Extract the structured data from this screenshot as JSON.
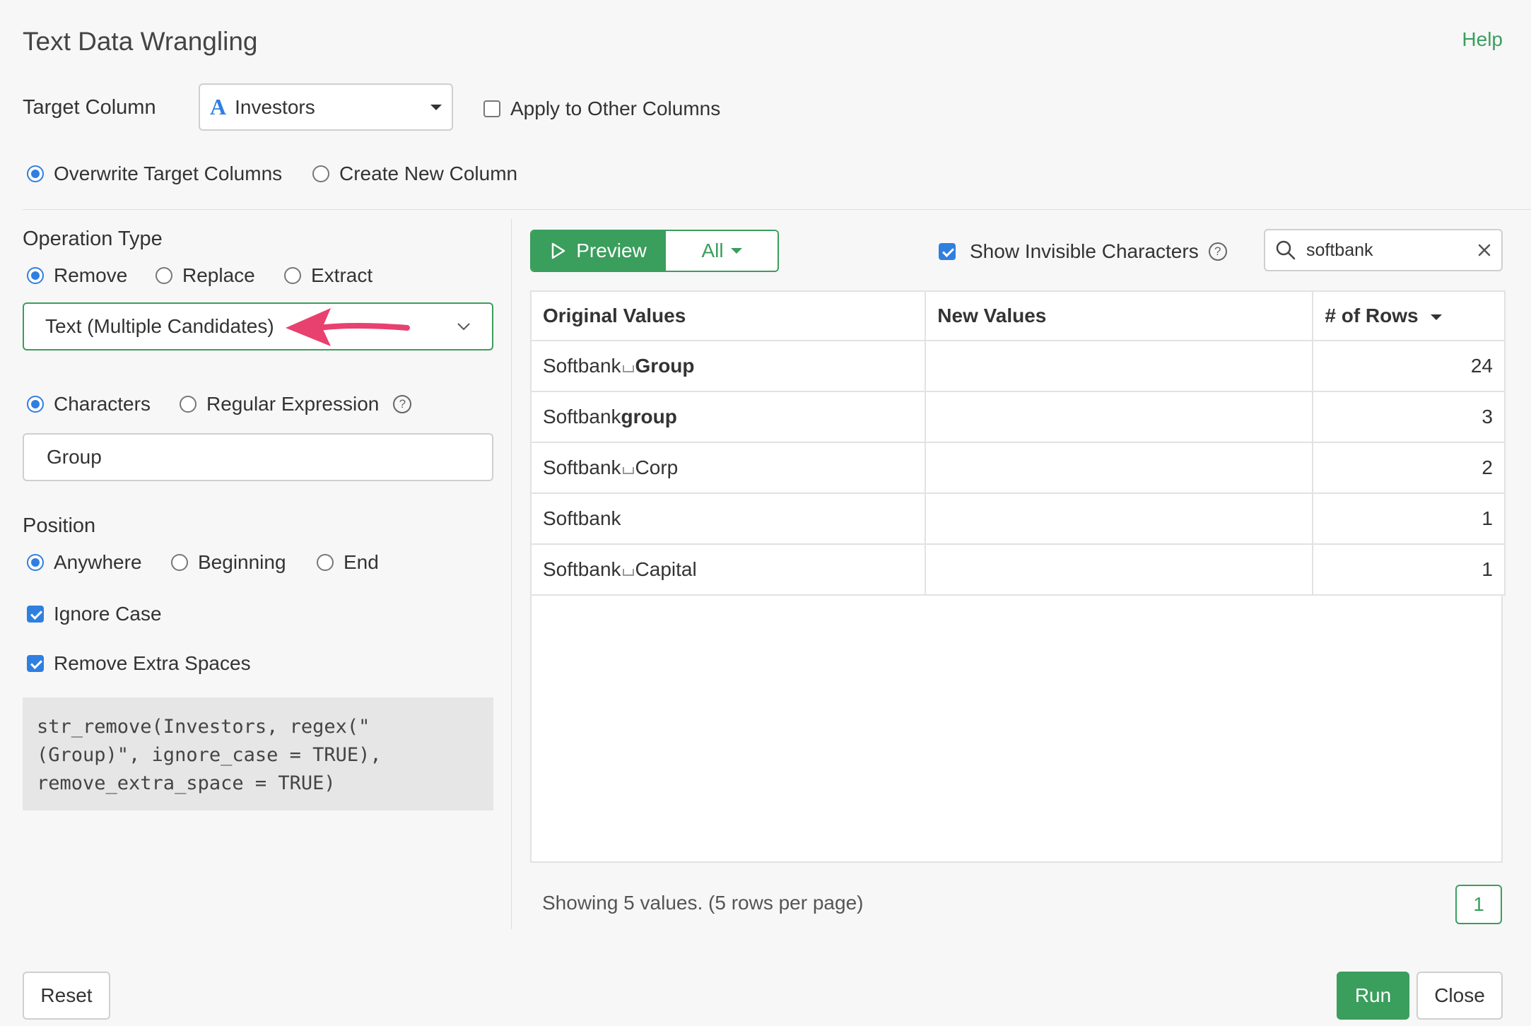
{
  "dialog": {
    "title": "Text Data Wrangling",
    "help_label": "Help"
  },
  "target": {
    "label": "Target Column",
    "type_icon_glyph": "A",
    "value": "Investors",
    "apply_other_label": "Apply to Other Columns",
    "apply_other_checked": false
  },
  "output_mode": {
    "options": [
      {
        "label": "Overwrite Target Columns",
        "selected": true
      },
      {
        "label": "Create New Column",
        "selected": false
      }
    ]
  },
  "operation": {
    "label": "Operation Type",
    "types": [
      {
        "label": "Remove",
        "selected": true
      },
      {
        "label": "Replace",
        "selected": false
      },
      {
        "label": "Extract",
        "selected": false
      }
    ],
    "mode_value": "Text (Multiple Candidates)",
    "match_types": [
      {
        "label": "Characters",
        "selected": true
      },
      {
        "label": "Regular Expression",
        "selected": false
      }
    ],
    "input_value": "Group"
  },
  "position": {
    "label": "Position",
    "options": [
      {
        "label": "Anywhere",
        "selected": true
      },
      {
        "label": "Beginning",
        "selected": false
      },
      {
        "label": "End",
        "selected": false
      }
    ],
    "ignore_case_label": "Ignore Case",
    "ignore_case_checked": true,
    "remove_spaces_label": "Remove Extra Spaces",
    "remove_spaces_checked": true
  },
  "code": "str_remove(Investors, regex(\"\n(Group)\", ignore_case = TRUE),\nremove_extra_space = TRUE)",
  "preview": {
    "preview_label": "Preview",
    "filter_label": "All",
    "show_invisible_label": "Show Invisible Characters",
    "show_invisible_checked": true,
    "search_value": "softbank",
    "columns": [
      "Original Values",
      "New Values",
      "# of Rows"
    ],
    "rows": [
      {
        "original_parts": [
          "Softbank",
          "Group"
        ],
        "space": true,
        "bold_second": true,
        "new": "",
        "count": "24"
      },
      {
        "original_parts": [
          "Softbank",
          "group"
        ],
        "space": false,
        "bold_second": true,
        "new": "",
        "count": "3"
      },
      {
        "original_parts": [
          "Softbank",
          "Corp"
        ],
        "space": true,
        "bold_second": false,
        "new": "",
        "count": "2"
      },
      {
        "original_parts": [
          "Softbank",
          ""
        ],
        "space": false,
        "bold_second": false,
        "new": "",
        "count": "1"
      },
      {
        "original_parts": [
          "Softbank",
          "Capital"
        ],
        "space": true,
        "bold_second": false,
        "new": "",
        "count": "1"
      }
    ],
    "summary": "Showing 5 values. (5 rows per page)",
    "page": "1"
  },
  "footer": {
    "reset_label": "Reset",
    "run_label": "Run",
    "close_label": "Close"
  },
  "colors": {
    "accent_green": "#3a9e5c",
    "checkbox_blue": "#2f7fe0",
    "arrow_pink": "#e8416f"
  }
}
